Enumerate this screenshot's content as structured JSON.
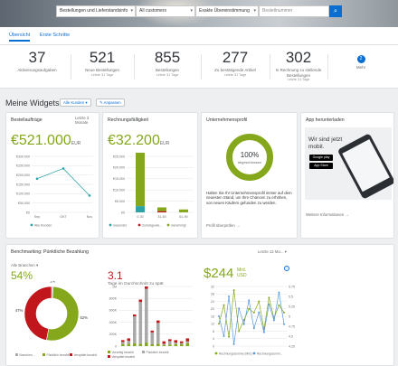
{
  "search": {
    "scope_value": "Bestellungen und Lieferstandsinfo",
    "customer_value": "All customers",
    "sort_value": "Exakte Übereinstimmung",
    "query_placeholder": "Bestellnummer"
  },
  "tabs": [
    "Übersicht",
    "Erste Schritte"
  ],
  "kpis": [
    {
      "value": "37",
      "label": "Aktivierungsaufgaben",
      "sub": ""
    },
    {
      "value": "521",
      "label": "Neue Bestellungen",
      "sub": "Letzte 31 Tage"
    },
    {
      "value": "855",
      "label": "Bestellungen",
      "sub": "Letzte 31 Tage"
    },
    {
      "value": "277",
      "label": "Zu bestätigende Artikel",
      "sub": "Letzte 31 Tage"
    },
    {
      "value": "302",
      "label": "In Rechnung zu stellende Bestellungen",
      "sub": "Letzte 31 Tage"
    }
  ],
  "more": {
    "badge": "2",
    "label": "Mehr"
  },
  "widgets": {
    "title": "Meine Widgets",
    "customer_filter": "Alle Kunden",
    "customize": "Anpassen"
  },
  "orders": {
    "title": "Bestellaufträge",
    "period": "Letzte 3 Monate",
    "value": "€521.000",
    "unit": "EUR",
    "legend": "Alle Kunden"
  },
  "invoices": {
    "title": "Rechnungsfälligkeit",
    "value": "€32.200",
    "unit": "EUR",
    "legend": [
      "Gesendet",
      "Zurückgewie...",
      "Genehmigt"
    ]
  },
  "profile": {
    "title": "Unternehmensprofil",
    "percent": "100%",
    "caption": "abgeschlossen",
    "text": "Halten Sie Ihr Unternehmensprofil immer auf dem neuesten Stand, um Ihre Chancen zu erhöhen, von neuen Käufern gefunden zu werden.",
    "link": "Profil überprüfen"
  },
  "app": {
    "title": "App herunterladen",
    "tagline": "Wir sind jetzt mobil.",
    "store_google": "Google play",
    "store_apple": "App Store",
    "link": "Weitere Informationen"
  },
  "benchmark": {
    "title": "Benchmarking: Pünktliche Bezahlung",
    "period": "Letzte 12 Mo...",
    "filter": "Alle Branchen",
    "pct": "54%",
    "days": "3.1",
    "days_label": "Tage im Durchschnitt zu spät",
    "amount": "$244",
    "amount_unit": "Mrd.",
    "amount_currency": "USD"
  },
  "pie_legend": [
    "Branchen...",
    "Pünktlich bezahlt",
    "Verspätet bezahlt"
  ],
  "bar2_legend": [
    "Vorzeitig bezahlt",
    "Pünktlich bezahlt",
    "Verspätet bezahlt"
  ],
  "line2_legend": [
    "Rechnungssumme (Mrd.)",
    "Rechnungssumm..."
  ],
  "colors": {
    "accent": "#0a6ed1",
    "green": "#84a71b",
    "red": "#c0161c",
    "teal": "#2da3a6",
    "grey": "#a9a9a9"
  },
  "chart_data": [
    {
      "type": "line",
      "title": "Bestellaufträge",
      "x": [
        "Sep",
        "OKT",
        "Nov"
      ],
      "series": [
        {
          "name": "Alle Kunden",
          "values": [
            180000,
            235000,
            90000
          ]
        }
      ],
      "yticks": [
        "€300.000",
        "€250.000",
        "€200.000",
        "€150.000",
        "€100.000",
        "€50.000",
        "€0"
      ],
      "ylim": [
        0,
        300000
      ]
    },
    {
      "type": "bar",
      "title": "Rechnungsfälligkeit",
      "categories": [
        "0-30",
        "31-60",
        "61-90"
      ],
      "series": [
        {
          "name": "Gesendet",
          "values": [
            3000,
            0,
            0
          ]
        },
        {
          "name": "Zurückgewie...",
          "values": [
            0,
            600,
            0
          ]
        },
        {
          "name": "Genehmigt",
          "values": [
            26500,
            1800,
            1400
          ]
        }
      ],
      "yticks": [
        "€25.000",
        "€20.000",
        "€15.000",
        "€10.000",
        "€5.000",
        "€0"
      ],
      "ylim": [
        0,
        27000
      ]
    },
    {
      "type": "pie",
      "slices": [
        {
          "name": "Branchen...",
          "value": 1,
          "label": "1%"
        },
        {
          "name": "Pünktlich bezahlt",
          "value": 52,
          "label": "52%"
        },
        {
          "name": "Verspätet bezahlt",
          "value": 47,
          "label": "47%"
        }
      ]
    },
    {
      "type": "bar",
      "yticks": [
        "1M",
        "800K",
        "600K",
        "400K",
        "200K",
        "0"
      ],
      "ylim": [
        0,
        1000000
      ],
      "series": [
        {
          "name": "Vorzeitig bezahlt",
          "values": [
            30000,
            40000,
            50000,
            40000,
            60000,
            30000,
            40000,
            20000,
            25000,
            30000,
            30000,
            50000
          ]
        },
        {
          "name": "Pünktlich bezahlt",
          "values": [
            40000,
            50000,
            450000,
            700000,
            900000,
            200000,
            350000,
            20000,
            60000,
            30000,
            20000,
            30000
          ]
        },
        {
          "name": "Verspätet bezahlt",
          "values": [
            30000,
            40000,
            30000,
            40000,
            40000,
            30000,
            40000,
            40000,
            30000,
            40000,
            30000,
            50000
          ]
        }
      ]
    },
    {
      "type": "line",
      "yticks_left": [
        "32",
        "28",
        "24",
        "20",
        "16",
        "12",
        "8",
        "4",
        "0"
      ],
      "yticks_right": [
        "5.75",
        "5.5",
        "5.25",
        "5",
        "4.75",
        "4.5",
        "4.25"
      ],
      "series": [
        {
          "name": "Rechnungssumme (Mrd.)",
          "values": [
            12,
            22,
            5,
            30,
            8,
            14,
            20,
            18,
            24,
            9,
            26,
            15,
            22,
            18
          ]
        },
        {
          "name": "Rechnungssumm...",
          "values": [
            5,
            4.5,
            5.5,
            4.3,
            5.2,
            4.8,
            5.4,
            4.7,
            5.1,
            4.6,
            5.3,
            4.9,
            5.6,
            4.8
          ]
        }
      ]
    }
  ]
}
